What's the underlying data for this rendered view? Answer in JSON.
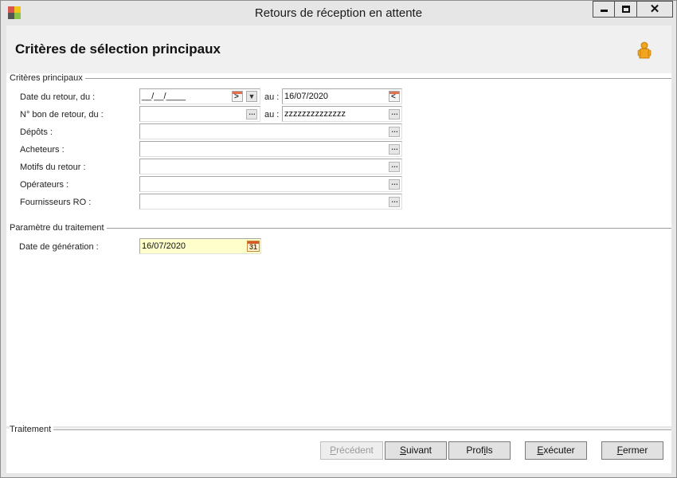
{
  "window": {
    "title": "Retours de réception en attente",
    "min_glyph": "",
    "close_glyph": "✕"
  },
  "header": {
    "title": "Critères de sélection principaux"
  },
  "groups": {
    "main_criteria": "Critères principaux",
    "processing_param": "Paramètre du traitement",
    "processing": "Traitement"
  },
  "fields": {
    "date_retour": {
      "label": "Date du retour, du :",
      "value_from": "__/__/____",
      "au_label": "au :",
      "value_to": "16/07/2020"
    },
    "bon_retour": {
      "label": "N° bon de retour, du :",
      "value_from": "",
      "au_label": "au :",
      "value_to": "zzzzzzzzzzzzzz"
    },
    "depots": {
      "label": "Dépôts :",
      "value": ""
    },
    "acheteurs": {
      "label": "Acheteurs :",
      "value": ""
    },
    "motifs": {
      "label": "Motifs du retour  :",
      "value": ""
    },
    "operateurs": {
      "label": "Opérateurs :",
      "value": ""
    },
    "fournisseurs": {
      "label": "Fournisseurs RO :",
      "value": ""
    },
    "date_generation": {
      "label": "Date de génération :",
      "value": "16/07/2020",
      "calendar_day": "31"
    }
  },
  "buttons": {
    "precedent": {
      "first": "P",
      "rest": "récédent"
    },
    "suivant": {
      "first": "S",
      "rest": "uivant"
    },
    "profils": {
      "first": "Prof",
      "ul": "i",
      "rest": "ls"
    },
    "executer": {
      "first": "E",
      "rest": "xécuter"
    },
    "fermer": {
      "first": "F",
      "rest": "ermer"
    }
  },
  "colors": {
    "accent_yellow_field": "#ffffcc",
    "window_chrome": "#e6e6e6"
  }
}
